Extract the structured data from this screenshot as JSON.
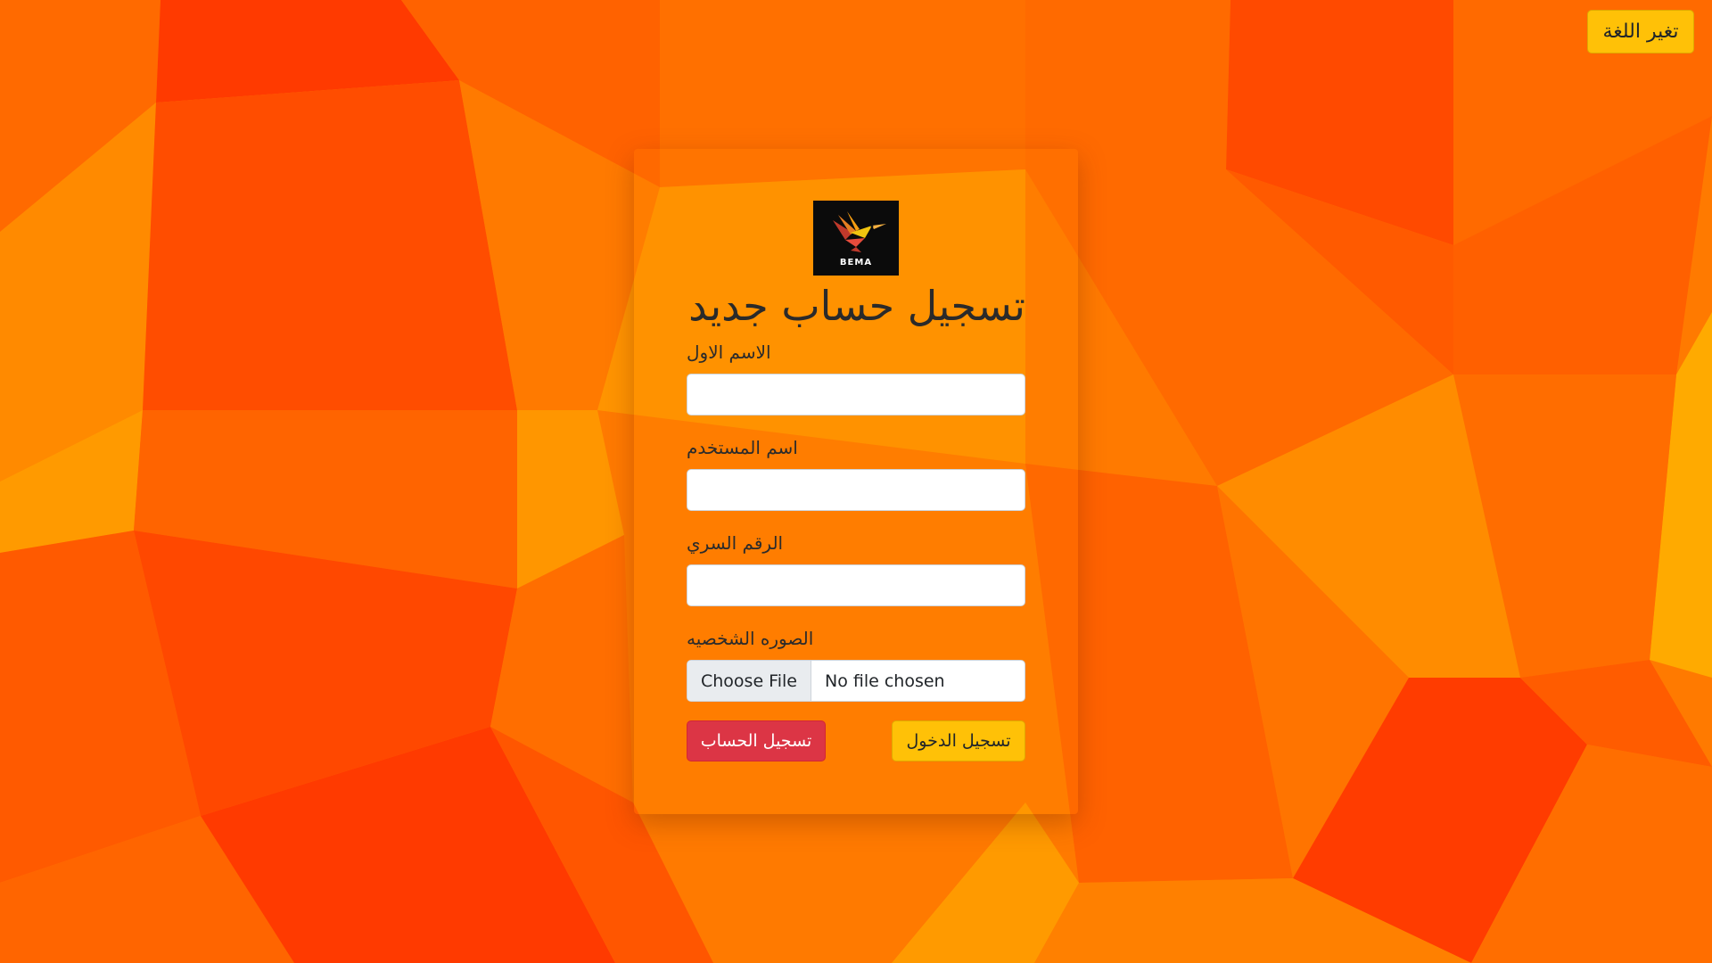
{
  "header": {
    "language_button_label": "تغير اللغة"
  },
  "logo": {
    "text": "BEMA"
  },
  "form": {
    "title": "تسجيل حساب جديد",
    "fields": [
      {
        "label": "الاسم الاول",
        "value": ""
      },
      {
        "label": "اسم المستخدم",
        "value": ""
      },
      {
        "label": "الرقم السري",
        "value": ""
      }
    ],
    "photo": {
      "label": "الصوره الشخصيه",
      "choose_button_label": "Choose File",
      "file_name": "No file chosen"
    },
    "register_button_label": "تسجيل الحساب",
    "login_button_label": "تسجيل الدخول"
  },
  "colors": {
    "background": "#ff7a00",
    "register_button": "#dc3545",
    "login_button": "#ffc107",
    "language_button": "#ffc107"
  }
}
